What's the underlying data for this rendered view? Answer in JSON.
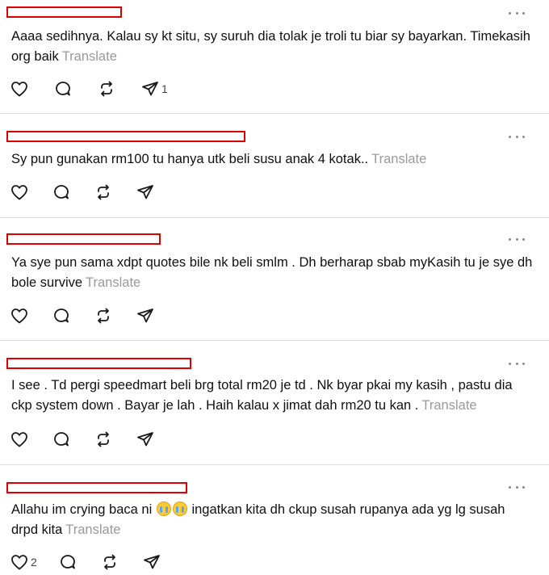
{
  "translate_label": "Translate",
  "posts": [
    {
      "text": "Aaaa sedihnya. Kalau sy kt situ, sy suruh dia tolak je troli tu biar sy bayarkan. Timekasih org baik",
      "likes": "",
      "replies": "",
      "reposts": "",
      "shares": "1"
    },
    {
      "text": "Sy pun gunakan rm100 tu hanya utk beli susu anak 4 kotak..",
      "likes": "",
      "replies": "",
      "reposts": "",
      "shares": ""
    },
    {
      "text": "Ya sye pun sama xdpt quotes bile nk beli smlm . Dh berharap sbab myKasih tu je sye dh bole survive",
      "likes": "",
      "replies": "",
      "reposts": "",
      "shares": ""
    },
    {
      "text": "I see . Td pergi speedmart beli brg total rm20 je td . Nk byar pkai my kasih , pastu dia ckp system down . Bayar je lah . Haih kalau x jimat dah rm20 tu kan .",
      "likes": "",
      "replies": "",
      "reposts": "",
      "shares": ""
    },
    {
      "text_before": "Allahu im crying baca ni",
      "text_after": "ingatkan kita dh ckup susah rupanya ada yg lg susah drpd kita",
      "emoji": "loudly-crying-face",
      "likes": "2",
      "replies": "",
      "reposts": "",
      "shares": ""
    }
  ],
  "colors": {
    "redaction": "#e00000",
    "translate": "#9a9a9a",
    "divider": "#dcdcdc"
  }
}
